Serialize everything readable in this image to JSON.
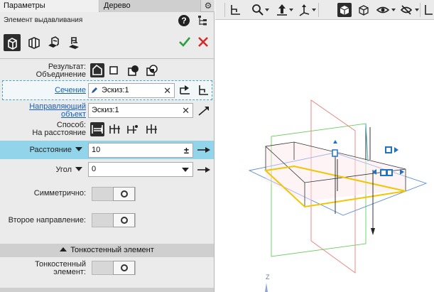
{
  "tabs": {
    "params": "Параметры",
    "tree": "Дерево"
  },
  "operation": {
    "title": "Элемент выдавливания"
  },
  "icons": {
    "gear": "gear-icon",
    "help": "help-icon",
    "tree": "tree-icon",
    "ok": "checkmark-icon",
    "cancel": "close-icon"
  },
  "colors": {
    "accent_row": "#92d4ea",
    "link": "#1560b8",
    "ok": "#2f9e3f",
    "cancel": "#d42a2a",
    "sketch": "#f2c500"
  },
  "result": {
    "label": "Результат:",
    "value": "Объединение"
  },
  "section": {
    "label": "Сечение",
    "value": "Эскиз:1",
    "clear": "✕"
  },
  "guide": {
    "label_line1": "Направляющий",
    "label_line2": "объект",
    "value": "Эскиз:1",
    "clear": "✕"
  },
  "method": {
    "label": "Способ:",
    "value": "На расстояние"
  },
  "distance": {
    "label": "Расстояние",
    "value": "10",
    "pm": "±"
  },
  "angle": {
    "label": "Угол",
    "value": "0"
  },
  "symmetric": {
    "label": "Симметрично:"
  },
  "second_direction": {
    "label": "Второе направление:"
  },
  "thin_wall": {
    "header": "Тонкостенный элемент",
    "label_line1": "Тонкостенный",
    "label_line2": "элемент:"
  },
  "viewport": {
    "axis_label": "Z"
  }
}
